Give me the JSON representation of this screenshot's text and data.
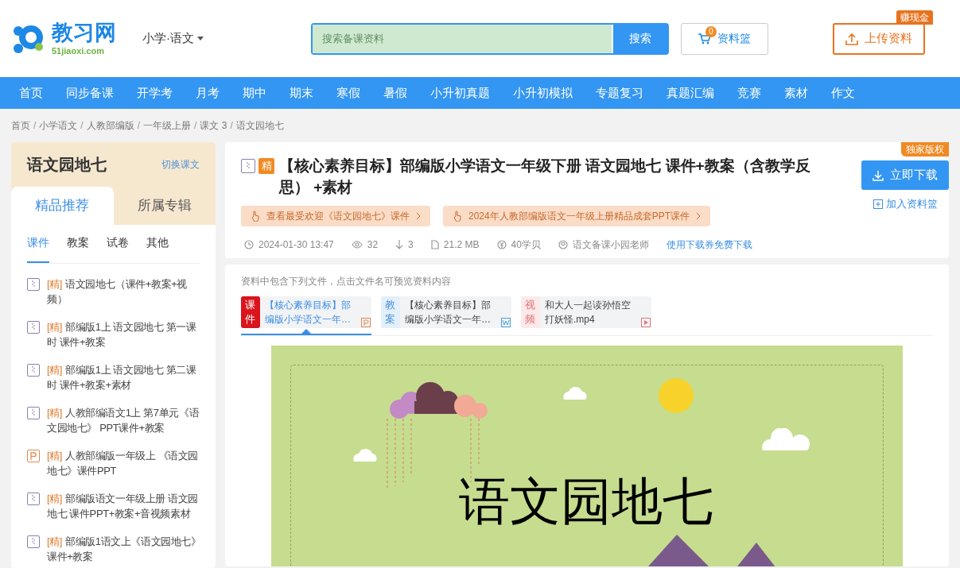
{
  "header": {
    "logo_text": "教习网",
    "logo_domain": "51jiaoxi.com",
    "subject": "小学·语文",
    "search": {
      "placeholder": "搜索备课资料",
      "button": "搜索"
    },
    "cart": {
      "label": "资料篮",
      "count": "0"
    },
    "upload": {
      "label": "上传资料",
      "badge": "赚现金"
    }
  },
  "nav": [
    "首页",
    "同步备课",
    "开学考",
    "月考",
    "期中",
    "期末",
    "寒假",
    "暑假",
    "小升初真题",
    "小升初模拟",
    "专题复习",
    "真题汇编",
    "竞赛",
    "素材",
    "作文"
  ],
  "breadcrumb": [
    {
      "label": "首页",
      "separator": "/"
    },
    {
      "label": "小学语文",
      "separator": "/"
    },
    {
      "label": "人教部编版",
      "separator": "/"
    },
    {
      "label": "一年级上册",
      "separator": "/"
    },
    {
      "label": "课文 3",
      "separator": "/"
    },
    {
      "label": "语文园地七"
    }
  ],
  "sidebar": {
    "title": "语文园地七",
    "switch_link": "切换课文",
    "tabs": [
      {
        "label": "精品推荐",
        "selected": true
      },
      {
        "label": "所属专辑",
        "selected": false
      }
    ],
    "subtabs": [
      {
        "label": "课件",
        "selected": true
      },
      {
        "label": "教案",
        "selected": false
      },
      {
        "label": "试卷",
        "selected": false
      },
      {
        "label": "其他",
        "selected": false
      }
    ],
    "items": [
      {
        "kind": "zip",
        "tag": "[精]",
        "title": "语文园地七（课件+教案+视频）"
      },
      {
        "kind": "zip",
        "tag": "[精]",
        "title": "部编版1上 语文园地七 第一课时 课件+教案"
      },
      {
        "kind": "zip",
        "tag": "[精]",
        "title": "部编版1上 语文园地七 第二课时 课件+教案+素材"
      },
      {
        "kind": "zip",
        "tag": "[精]",
        "title": "人教部编语文1上 第7单元《语文园地七》 PPT课件+教案"
      },
      {
        "kind": "ppt",
        "tag": "[精]",
        "title": "人教部编版一年级上 《语文园地七》课件PPT"
      },
      {
        "kind": "zip",
        "tag": "[精]",
        "title": "部编版语文一年级上册 语文园地七 课件PPT+教案+音视频素材"
      },
      {
        "kind": "zip",
        "tag": "[精]",
        "title": "部编版1语文上《语文园地七》课件+教案"
      }
    ]
  },
  "resource": {
    "corner_badge": "独家版权",
    "premium_badge": "精",
    "title": "【核心素养目标】部编版小学语文一年级下册 语文园地七 课件+教案（含教学反思） +素材",
    "download_button": "立即下载",
    "add_to_cart": "加入资料篮",
    "promos": [
      "查看最受欢迎《语文园地七》课件",
      "2024年人教部编版语文一年级上册精品成套PPT课件"
    ],
    "meta": {
      "date": "2024-01-30 13:47",
      "views": "32",
      "downloads": "3",
      "size": "21.2 MB",
      "price": "40学贝",
      "author": "语文备课小园老师",
      "coupon_link": "使用下载券免费下载"
    }
  },
  "files": {
    "hint": "资料中包含下列文件，点击文件名可预览资料内容",
    "items": [
      {
        "kind": "ppt",
        "type_label": "课件",
        "name": "【核心素养目标】部编版小学语文一年…",
        "selected": true
      },
      {
        "kind": "word",
        "type_label": "教案",
        "name": "【核心素养目标】部编版小学语文一年…",
        "selected": false
      },
      {
        "kind": "video",
        "type_label": "视频",
        "name": "和大人一起读孙悟空打妖怪.mp4",
        "selected": false
      }
    ]
  },
  "preview": {
    "slide_title": "语文园地七"
  }
}
